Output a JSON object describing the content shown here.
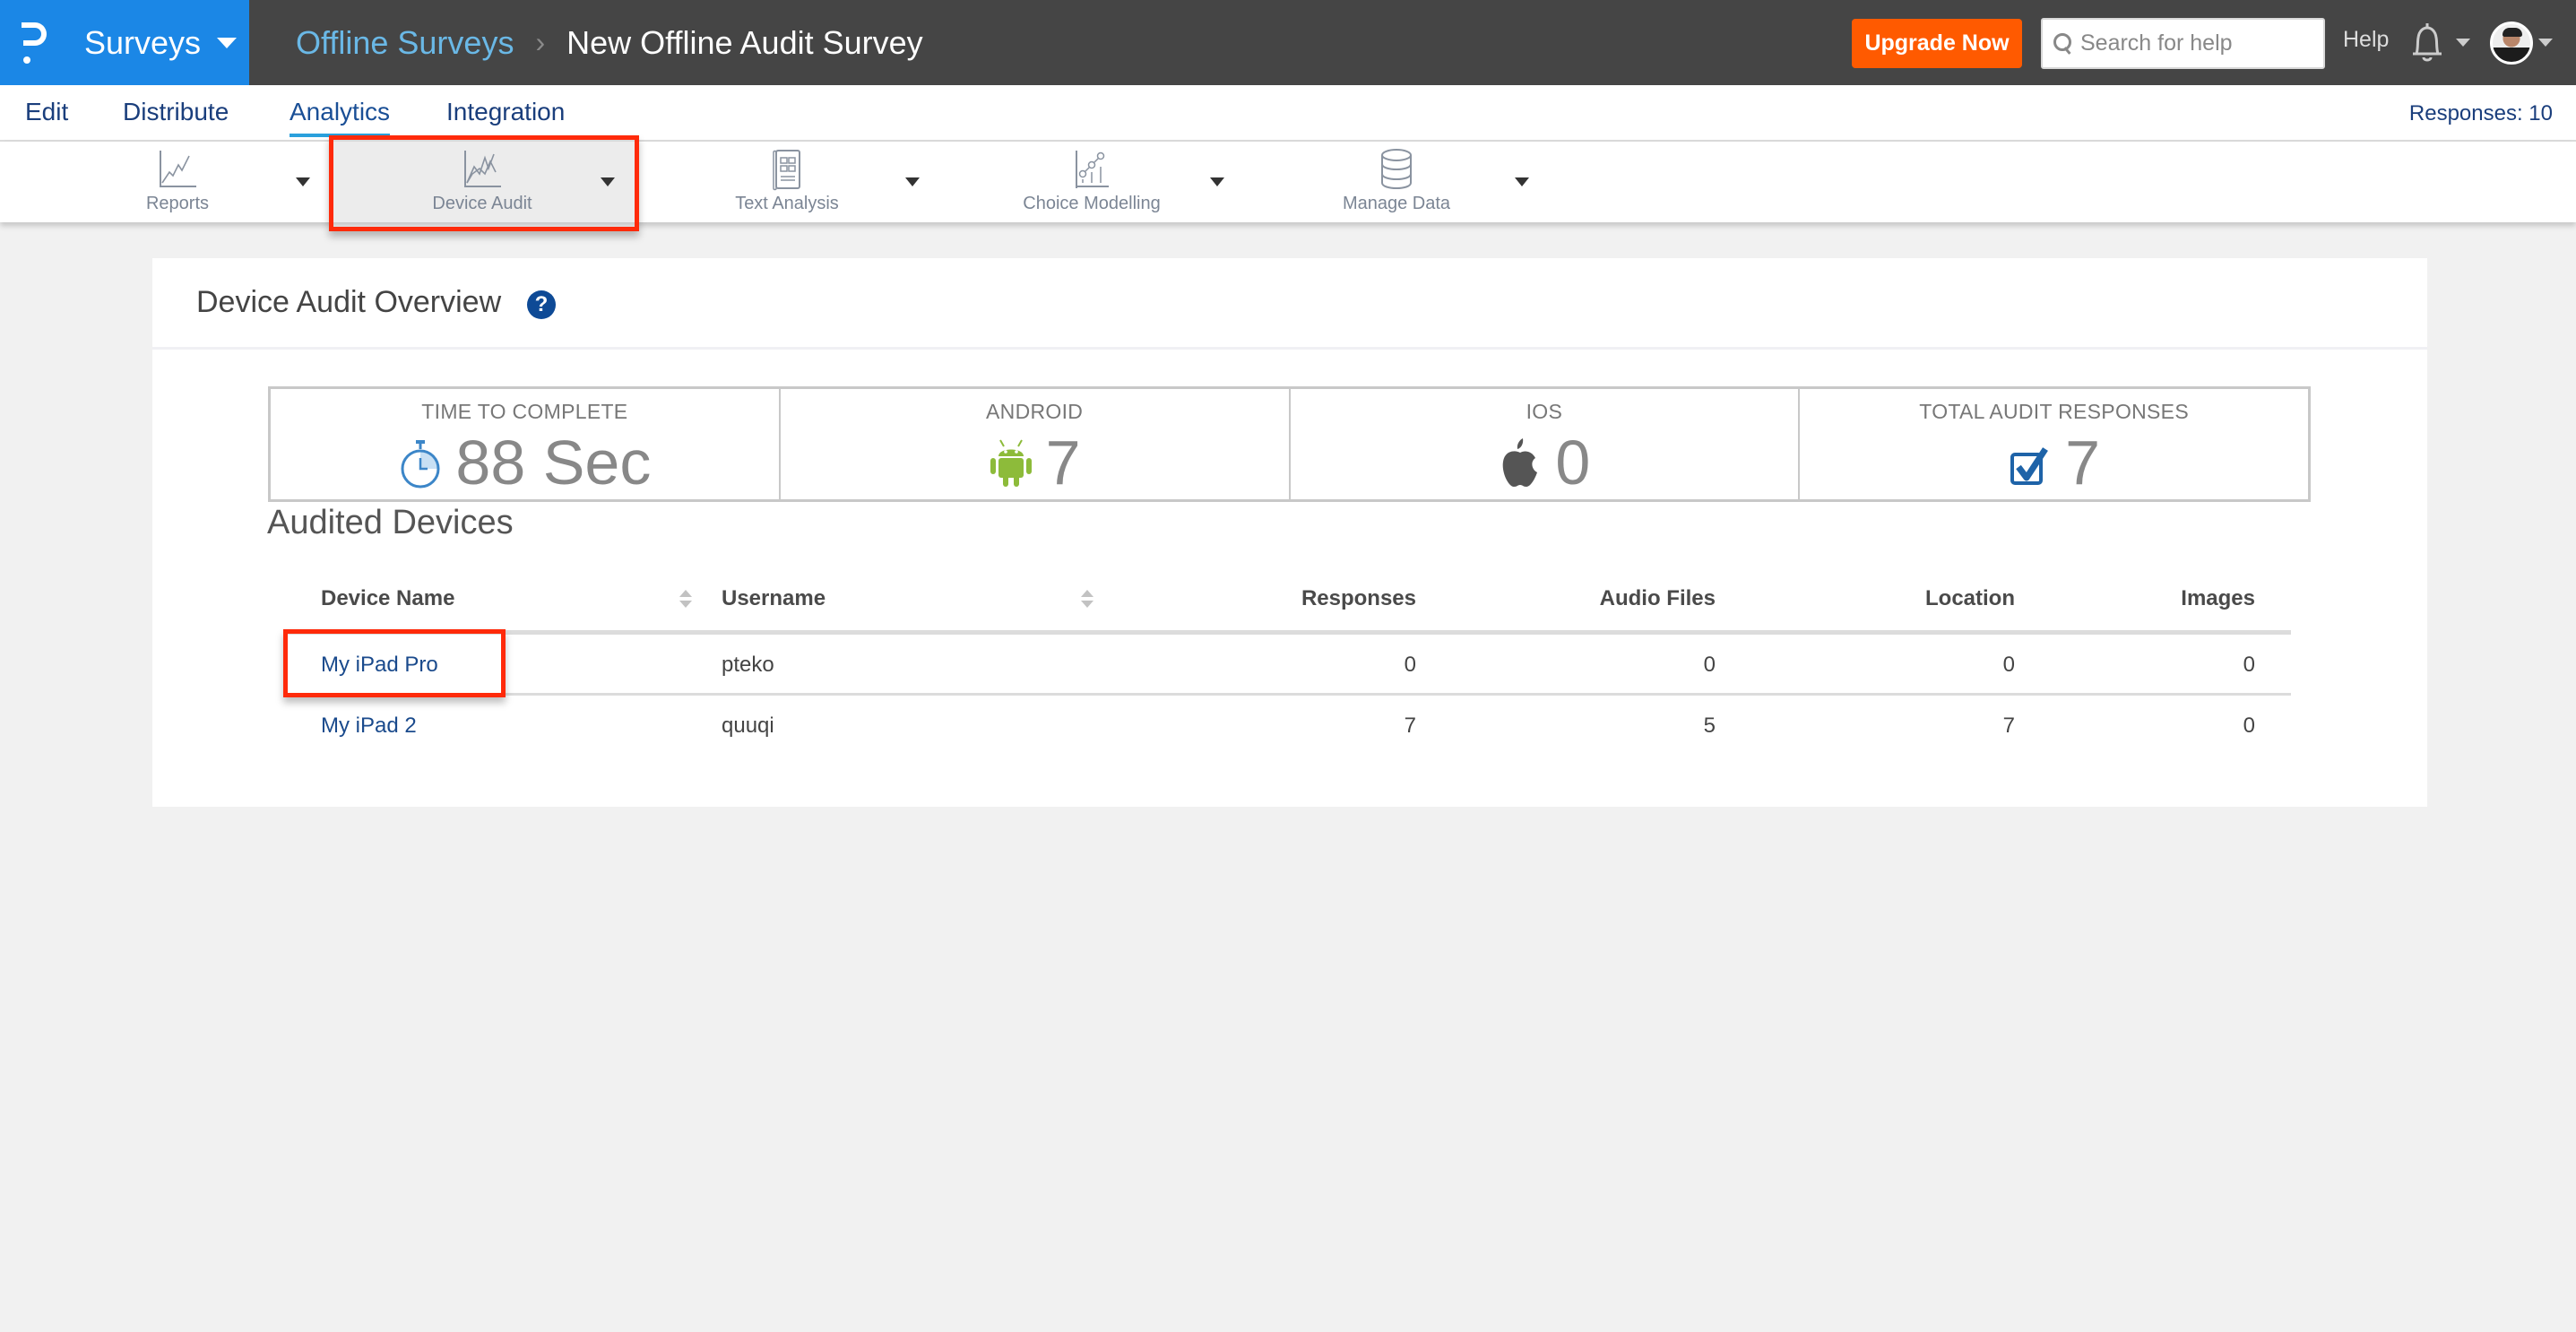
{
  "topbar": {
    "app_name": "Surveys",
    "breadcrumb": [
      {
        "label": "Offline Surveys"
      },
      {
        "label": "New Offline Audit Survey"
      }
    ],
    "breadcrumb_separator": "›",
    "upgrade_label": "Upgrade Now",
    "search_placeholder": "Search for help",
    "search_value": "",
    "help_label": "Help",
    "colors": {
      "brand": "#1b87e6",
      "bar": "#454545",
      "upgrade": "#ff5a00"
    }
  },
  "nav": {
    "tabs": [
      {
        "label": "Edit",
        "active": false
      },
      {
        "label": "Distribute",
        "active": false
      },
      {
        "label": "Analytics",
        "active": true
      },
      {
        "label": "Integration",
        "active": false
      }
    ],
    "responses_label": "Responses: 10"
  },
  "toolbar": {
    "items": [
      {
        "label": "Reports",
        "icon": "line-chart-icon",
        "active": false
      },
      {
        "label": "Device Audit",
        "icon": "multi-line-chart-icon",
        "active": true
      },
      {
        "label": "Text Analysis",
        "icon": "document-grid-icon",
        "active": false
      },
      {
        "label": "Choice Modelling",
        "icon": "scatter-bar-chart-icon",
        "active": false
      },
      {
        "label": "Manage Data",
        "icon": "database-icon",
        "active": false
      }
    ]
  },
  "overview": {
    "title": "Device Audit Overview",
    "help_glyph": "?",
    "stats": [
      {
        "label": "TIME TO COMPLETE",
        "value": "88 Sec",
        "icon": "stopwatch-icon"
      },
      {
        "label": "ANDROID",
        "value": "7",
        "icon": "android-icon"
      },
      {
        "label": "IOS",
        "value": "0",
        "icon": "apple-icon"
      },
      {
        "label": "TOTAL AUDIT RESPONSES",
        "value": "7",
        "icon": "checkbox-icon"
      }
    ]
  },
  "devices": {
    "title": "Audited Devices",
    "columns": [
      "Device Name",
      "Username",
      "Responses",
      "Audio Files",
      "Location",
      "Images"
    ],
    "rows": [
      {
        "device": "My iPad Pro",
        "username": "pteko",
        "responses": "0",
        "audio": "0",
        "location": "0",
        "images": "0"
      },
      {
        "device": "My iPad 2",
        "username": "quuqi",
        "responses": "7",
        "audio": "5",
        "location": "7",
        "images": "0"
      }
    ]
  },
  "annotations": {
    "highlight_color": "#ff2a0a"
  }
}
